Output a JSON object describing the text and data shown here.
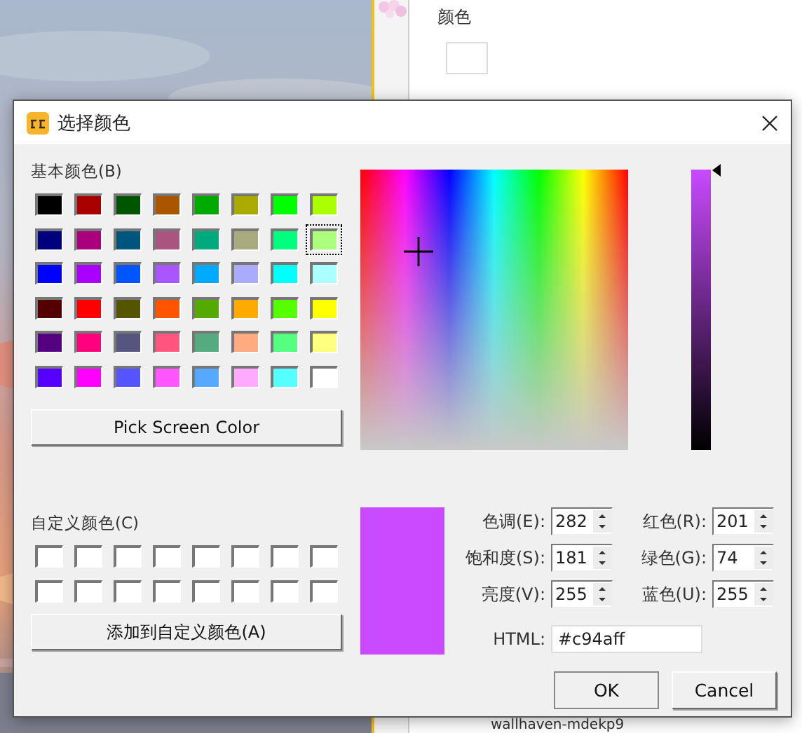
{
  "background": {
    "panel_label": "颜色",
    "bottom_item": "wallhaven-mdekp9"
  },
  "dialog": {
    "title": "选择颜色",
    "basic_colors_label": "基本颜色(B)",
    "basic_colors": [
      {
        "color": "#000000",
        "selected": false
      },
      {
        "color": "#aa0000",
        "selected": false
      },
      {
        "color": "#005500",
        "selected": false
      },
      {
        "color": "#aa5500",
        "selected": false
      },
      {
        "color": "#00aa00",
        "selected": false
      },
      {
        "color": "#aaaa00",
        "selected": false
      },
      {
        "color": "#00ff00",
        "selected": false
      },
      {
        "color": "#aaff00",
        "selected": false
      },
      {
        "color": "#00007f",
        "selected": false
      },
      {
        "color": "#aa007f",
        "selected": false
      },
      {
        "color": "#00557f",
        "selected": false
      },
      {
        "color": "#aa557f",
        "selected": false
      },
      {
        "color": "#00aa7f",
        "selected": false
      },
      {
        "color": "#aaaa7f",
        "selected": false
      },
      {
        "color": "#00ff7f",
        "selected": false
      },
      {
        "color": "#aaff7f",
        "selected": true
      },
      {
        "color": "#0000ff",
        "selected": false
      },
      {
        "color": "#aa00ff",
        "selected": false
      },
      {
        "color": "#0055ff",
        "selected": false
      },
      {
        "color": "#aa55ff",
        "selected": false
      },
      {
        "color": "#00aaff",
        "selected": false
      },
      {
        "color": "#aaaaff",
        "selected": false
      },
      {
        "color": "#00ffff",
        "selected": false
      },
      {
        "color": "#aaffff",
        "selected": false
      },
      {
        "color": "#550000",
        "selected": false
      },
      {
        "color": "#ff0000",
        "selected": false
      },
      {
        "color": "#555500",
        "selected": false
      },
      {
        "color": "#ff5500",
        "selected": false
      },
      {
        "color": "#55aa00",
        "selected": false
      },
      {
        "color": "#ffaa00",
        "selected": false
      },
      {
        "color": "#55ff00",
        "selected": false
      },
      {
        "color": "#ffff00",
        "selected": false
      },
      {
        "color": "#55007f",
        "selected": false
      },
      {
        "color": "#ff007f",
        "selected": false
      },
      {
        "color": "#55557f",
        "selected": false
      },
      {
        "color": "#ff557f",
        "selected": false
      },
      {
        "color": "#55aa7f",
        "selected": false
      },
      {
        "color": "#ffaa7f",
        "selected": false
      },
      {
        "color": "#55ff7f",
        "selected": false
      },
      {
        "color": "#ffff7f",
        "selected": false
      },
      {
        "color": "#5500ff",
        "selected": false
      },
      {
        "color": "#ff00ff",
        "selected": false
      },
      {
        "color": "#5555ff",
        "selected": false
      },
      {
        "color": "#ff55ff",
        "selected": false
      },
      {
        "color": "#55aaff",
        "selected": false
      },
      {
        "color": "#ffaaff",
        "selected": false
      },
      {
        "color": "#55ffff",
        "selected": false
      },
      {
        "color": "#ffffff",
        "selected": false
      }
    ],
    "pick_screen_button": "Pick Screen Color",
    "custom_colors_label": "自定义颜色(C)",
    "custom_colors": [
      {
        "color": "#ffffff"
      },
      {
        "color": "#ffffff"
      },
      {
        "color": "#ffffff"
      },
      {
        "color": "#ffffff"
      },
      {
        "color": "#ffffff"
      },
      {
        "color": "#ffffff"
      },
      {
        "color": "#ffffff"
      },
      {
        "color": "#ffffff"
      },
      {
        "color": "#ffffff"
      },
      {
        "color": "#ffffff"
      },
      {
        "color": "#ffffff"
      },
      {
        "color": "#ffffff"
      },
      {
        "color": "#ffffff"
      },
      {
        "color": "#ffffff"
      },
      {
        "color": "#ffffff"
      },
      {
        "color": "#ffffff"
      }
    ],
    "add_custom_button": "添加到自定义颜色(A)",
    "luminance": {
      "level": 1
    },
    "fields": [
      {
        "label": "色调(E):",
        "value": "282"
      },
      {
        "label": "红色(R):",
        "value": "201"
      },
      {
        "label": "饱和度(S):",
        "value": "181"
      },
      {
        "label": "绿色(G):",
        "value": "74"
      },
      {
        "label": "亮度(V):",
        "value": "255"
      },
      {
        "label": "蓝色(U):",
        "value": "255"
      }
    ],
    "html": {
      "label": "HTML:",
      "value": "#c94aff"
    },
    "buttons": [
      "OK",
      "Cancel"
    ]
  }
}
